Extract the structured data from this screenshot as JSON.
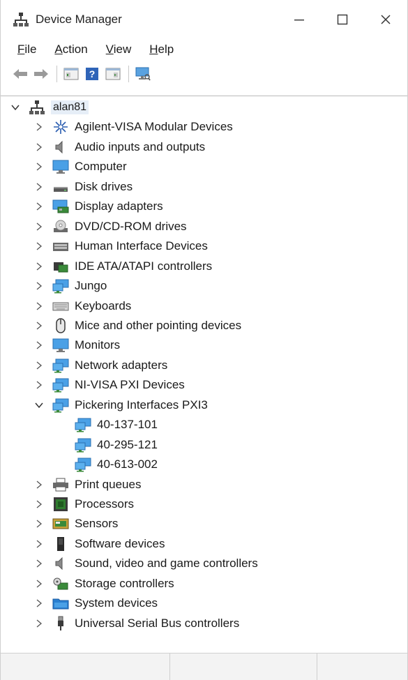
{
  "window": {
    "title": "Device Manager",
    "controls": {
      "minimize": "minimize-icon",
      "maximize": "maximize-icon",
      "close": "close-icon"
    }
  },
  "menu": [
    {
      "accel": "F",
      "rest": "ile"
    },
    {
      "accel": "A",
      "rest": "ction"
    },
    {
      "accel": "V",
      "rest": "iew"
    },
    {
      "accel": "H",
      "rest": "elp"
    }
  ],
  "toolbar": [
    "back-arrow-icon",
    "forward-arrow-icon",
    "properties-icon",
    "help-icon",
    "update-driver-icon",
    "scan-hardware-icon"
  ],
  "tree": {
    "root": "alan81",
    "categories": [
      {
        "label": "Agilent-VISA Modular Devices",
        "icon": "agilent-icon"
      },
      {
        "label": "Audio inputs and outputs",
        "icon": "speaker-icon"
      },
      {
        "label": "Computer",
        "icon": "monitor-icon"
      },
      {
        "label": "Disk drives",
        "icon": "disk-drive-icon"
      },
      {
        "label": "Display adapters",
        "icon": "display-adapter-icon"
      },
      {
        "label": "DVD/CD-ROM drives",
        "icon": "dvd-icon"
      },
      {
        "label": "Human Interface Devices",
        "icon": "hid-icon"
      },
      {
        "label": "IDE ATA/ATAPI controllers",
        "icon": "ide-controller-icon"
      },
      {
        "label": "Jungo",
        "icon": "network-device-icon"
      },
      {
        "label": "Keyboards",
        "icon": "keyboard-icon"
      },
      {
        "label": "Mice and other pointing devices",
        "icon": "mouse-icon"
      },
      {
        "label": "Monitors",
        "icon": "monitor-icon"
      },
      {
        "label": "Network adapters",
        "icon": "network-device-icon"
      },
      {
        "label": "NI-VISA PXI Devices",
        "icon": "network-device-icon"
      },
      {
        "label": "Pickering Interfaces PXI3",
        "icon": "network-device-icon",
        "expanded": true,
        "children": [
          "40-137-101",
          "40-295-121",
          "40-613-002"
        ]
      },
      {
        "label": "Print queues",
        "icon": "printer-icon"
      },
      {
        "label": "Processors",
        "icon": "processor-icon"
      },
      {
        "label": "Sensors",
        "icon": "sensor-icon"
      },
      {
        "label": "Software devices",
        "icon": "software-device-icon"
      },
      {
        "label": "Sound, video and game controllers",
        "icon": "speaker-icon"
      },
      {
        "label": "Storage controllers",
        "icon": "storage-controller-icon"
      },
      {
        "label": "System devices",
        "icon": "system-folder-icon"
      },
      {
        "label": "Universal Serial Bus controllers",
        "icon": "usb-icon"
      }
    ]
  },
  "colors": {
    "selection": "#e6eef7",
    "accent_blue": "#1e7fd6",
    "chevron": "#555555"
  }
}
